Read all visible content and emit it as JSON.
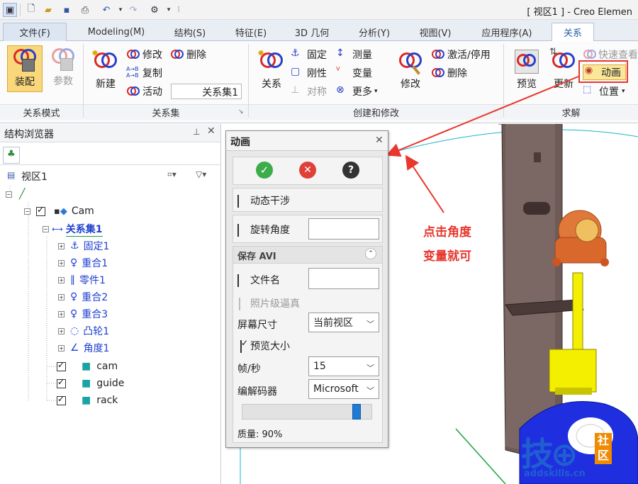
{
  "window": {
    "title": "[ 视区1 ] - Creo Elemen"
  },
  "tabs": [
    "文件(F)",
    "Modeling(M)",
    "结构(S)",
    "特征(E)",
    "3D 几何",
    "分析(Y)",
    "视图(V)",
    "应用程序(A)",
    "关系"
  ],
  "ribbon": {
    "groups": {
      "mode": "关系模式",
      "set": "关系集",
      "create": "创建和修改",
      "solve": "求解"
    },
    "mode": {
      "assemble": "装配",
      "parameters": "参数"
    },
    "set": {
      "new": "新建",
      "modify": "修改",
      "delete": "删除",
      "copy": "复制",
      "active": "活动",
      "relation_set_value": "关系集1"
    },
    "create": {
      "relation": "关系",
      "fixed": "固定",
      "rigid": "刚性",
      "symmetric": "对称",
      "measure": "测量",
      "variable": "变量",
      "more": "更多",
      "modify": "修改",
      "activate": "激活/停用",
      "delete": "删除"
    },
    "solve": {
      "preview": "预览",
      "update": "更新",
      "quick_check": "快速查看",
      "animate": "动画",
      "position": "位置"
    }
  },
  "browser": {
    "title": "结构浏览器",
    "view_label": "视区1",
    "items": [
      {
        "label": ""
      },
      {
        "label": "Cam"
      },
      {
        "label": "关系集1"
      },
      {
        "label": "固定1"
      },
      {
        "label": "重合1"
      },
      {
        "label": "零件1"
      },
      {
        "label": "重合2"
      },
      {
        "label": "重合3"
      },
      {
        "label": "凸轮1"
      },
      {
        "label": "角度1"
      },
      {
        "label": "cam"
      },
      {
        "label": "guide"
      },
      {
        "label": "rack"
      }
    ]
  },
  "dialog": {
    "title": "动画",
    "dynamic_interference": "动态干涉",
    "rotation_angle": "旋转角度",
    "save_avi": "保存 AVI",
    "file_name": "文件名",
    "photo_realistic": "照片级逼真",
    "screen_size_label": "屏幕尺寸",
    "screen_size_value": "当前视区",
    "preview_size": "预览大小",
    "fps_label": "帧/秒",
    "fps_value": "15",
    "codec_label": "编解码器",
    "codec_value": "Microsoft",
    "quality_label": "质量: 90%",
    "quality": 0.9
  },
  "annotation": {
    "line1": "点击角度",
    "line2": "变量就可",
    "color": "#e8372d"
  },
  "watermark": {
    "site": "addskills.cn"
  },
  "colors": {
    "accent": "#e8372d",
    "active_tab": "#2b5fa8",
    "link": "#1f3fd0",
    "part_yellow": "#f4ef00",
    "part_blue": "#1f2fe0",
    "part_brown": "#6e5a56"
  }
}
